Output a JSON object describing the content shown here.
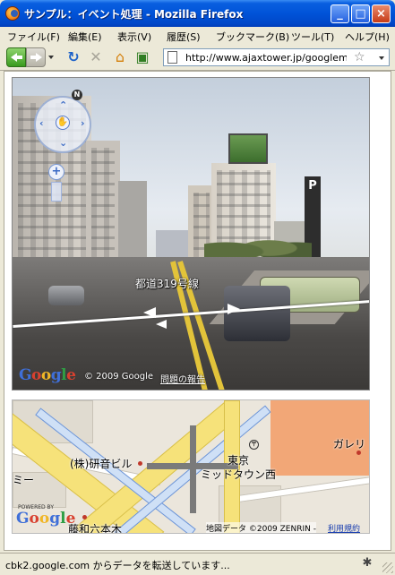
{
  "window": {
    "title": "サンプル：イベント処理 - Mozilla Firefox",
    "buttons": {
      "minimize": "_",
      "maximize": "□",
      "close": "×"
    }
  },
  "menubar": {
    "items": [
      {
        "label": "ファイル(F)"
      },
      {
        "label": "編集(E)"
      },
      {
        "label": "表示(V)"
      },
      {
        "label": "履歴(S)"
      },
      {
        "label": "ブックマーク(B)"
      },
      {
        "label": "ツール(T)"
      },
      {
        "label": "ヘルプ(H)"
      }
    ]
  },
  "navbar": {
    "url": "http://www.ajaxtower.jp/googlemap"
  },
  "streetview": {
    "road_label": "都道319号線",
    "compass": "N",
    "zoom_in": "+",
    "copyright": "© 2009 Google",
    "report_link": "問題の報告"
  },
  "map": {
    "labels": {
      "building": "(株)研音ビル",
      "tokyo": "東京",
      "midtown": "ミッドタウン西",
      "galleria": "ガレリ",
      "roppongi": "藤和六本木",
      "left_edge": "ミー"
    },
    "powered_by": "POWERED BY",
    "copyright": "地図データ ©2009 ZENRIN -",
    "terms_link": "利用規約"
  },
  "status": {
    "text": "cbk2.google.com からデータを転送しています..."
  },
  "colors": {
    "titlebar": "#0053d8",
    "map_orange": "#f2a777",
    "road_yellow": "#f6e27a",
    "road_blue": "#6e95d6"
  }
}
